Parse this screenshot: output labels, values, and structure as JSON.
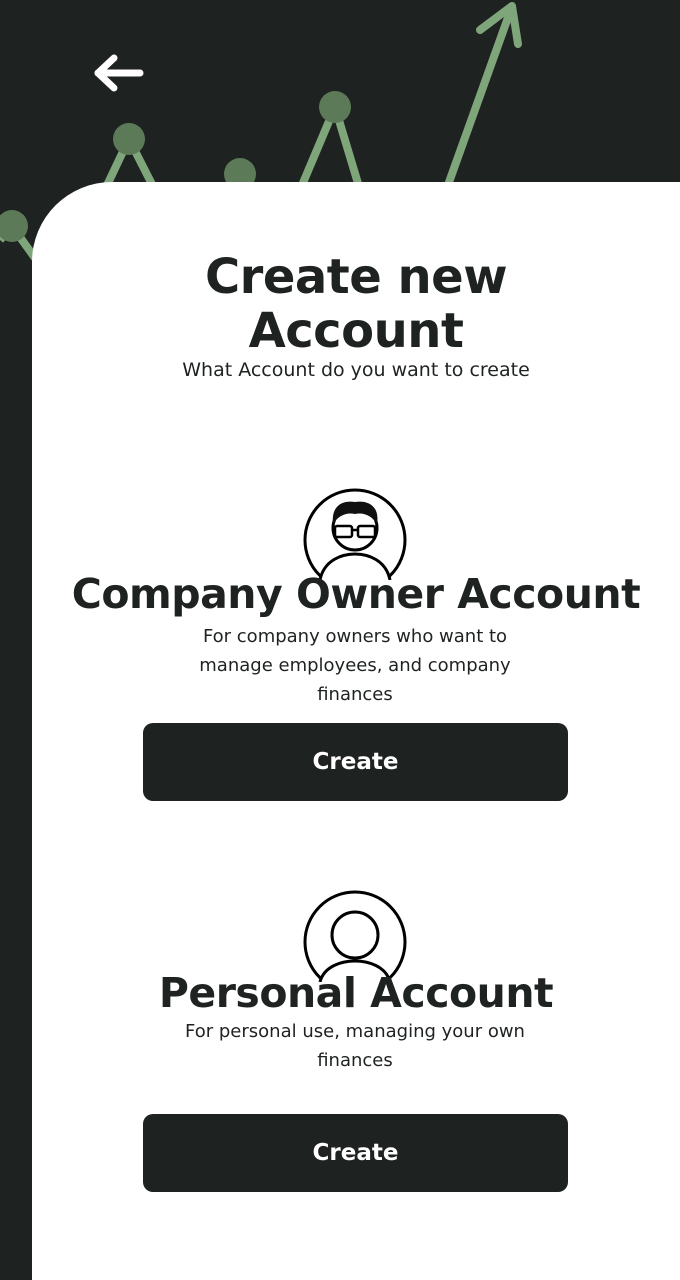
{
  "header": {
    "back_icon": "arrow-left-icon"
  },
  "page": {
    "title_line1": "Create new",
    "title_line2": "Account",
    "subtitle": "What Account do you want to create"
  },
  "accounts": [
    {
      "icon": "business-person-avatar-icon",
      "title": "Company Owner Account",
      "description": "For company owners who want to manage employees, and company finances",
      "button_label": "Create"
    },
    {
      "icon": "person-avatar-icon",
      "title": "Personal Account",
      "description": "For personal use, managing your own finances",
      "button_label": "Create"
    }
  ],
  "colors": {
    "background": "#1e2220",
    "card": "#ffffff",
    "accent_green": "#7fa67a",
    "dot_green": "#5d7a58",
    "text": "#1e2220"
  }
}
